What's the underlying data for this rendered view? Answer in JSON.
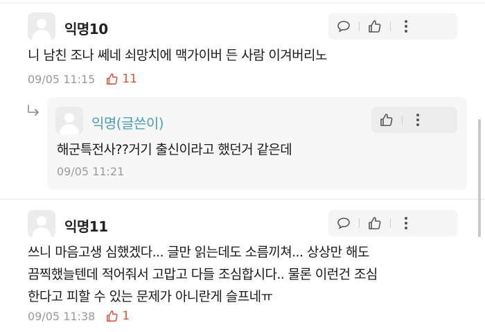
{
  "comments": [
    {
      "author": "익명10",
      "text_lines": [
        "니 남친 조나 쎄네 쇠망치에 맥가이버 든 사람 이겨버리노"
      ],
      "timestamp": "09/05 11:15",
      "likes": "11"
    },
    {
      "author": "익명(글쓴이)",
      "is_reply": true,
      "text_lines": [
        "해군특전사??거기 출신이라고 했던거 같은데"
      ],
      "timestamp": "09/05 11:21"
    },
    {
      "author": "익명11",
      "text_lines": [
        "쓰니 마음고생 심했겠다... 글만 읽는데도 소름끼쳐... 상상만 해도",
        "끔찍했늘텐데 적어줘서 고맙고 다들 조심합시다.. 물론 이런건 조심",
        "한다고 피할 수 있는 문제가 아니란게 슬프네ㅠ"
      ],
      "timestamp": "09/05 11:38",
      "likes": "1"
    }
  ],
  "icons": {
    "reply": "speech-bubble-icon",
    "like": "thumbs-up-icon",
    "more": "vertical-ellipsis-icon",
    "reply_arrow": "reply-arrow-icon"
  },
  "colors": {
    "like": "#e0523a",
    "op_author": "#4a9fb5",
    "meta": "#9a9a9a"
  }
}
